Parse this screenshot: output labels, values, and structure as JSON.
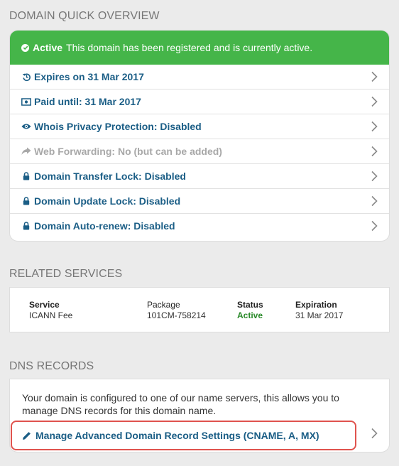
{
  "overview": {
    "title": "DOMAIN QUICK OVERVIEW",
    "status_label": "Active",
    "status_message": "This domain has been registered and is currently active.",
    "items": [
      {
        "label": "Expires on 31 Mar 2017",
        "icon": "history-icon",
        "muted": false
      },
      {
        "label": "Paid until: 31 Mar 2017",
        "icon": "money-icon",
        "muted": false
      },
      {
        "label": "Whois Privacy Protection: Disabled",
        "icon": "eye-icon",
        "muted": false
      },
      {
        "label": "Web Forwarding: No (but can be added)",
        "icon": "share-arrow-icon",
        "muted": true
      },
      {
        "label": "Domain Transfer Lock: Disabled",
        "icon": "lock-icon",
        "muted": false
      },
      {
        "label": "Domain Update Lock: Disabled",
        "icon": "lock-icon",
        "muted": false
      },
      {
        "label": "Domain Auto-renew: Disabled",
        "icon": "lock-icon",
        "muted": false
      }
    ]
  },
  "related": {
    "title": "RELATED SERVICES",
    "headers": {
      "service": "Service",
      "package": "Package",
      "status": "Status",
      "expiration": "Expiration"
    },
    "row": {
      "service": "ICANN Fee",
      "package": "101CM-758214",
      "status": "Active",
      "expiration": "31 Mar 2017"
    }
  },
  "dns": {
    "title": "DNS RECORDS",
    "description": "Your domain is configured to one of our name servers, this allows you to manage DNS records for this domain name.",
    "manage_label": "Manage Advanced Domain Record Settings (CNAME, A, MX)"
  },
  "colors": {
    "banner": "#45b549",
    "link": "#1b5e86",
    "muted": "#a8a8a8",
    "highlight_border": "#e0534e",
    "active_status": "#2a8a2a"
  }
}
